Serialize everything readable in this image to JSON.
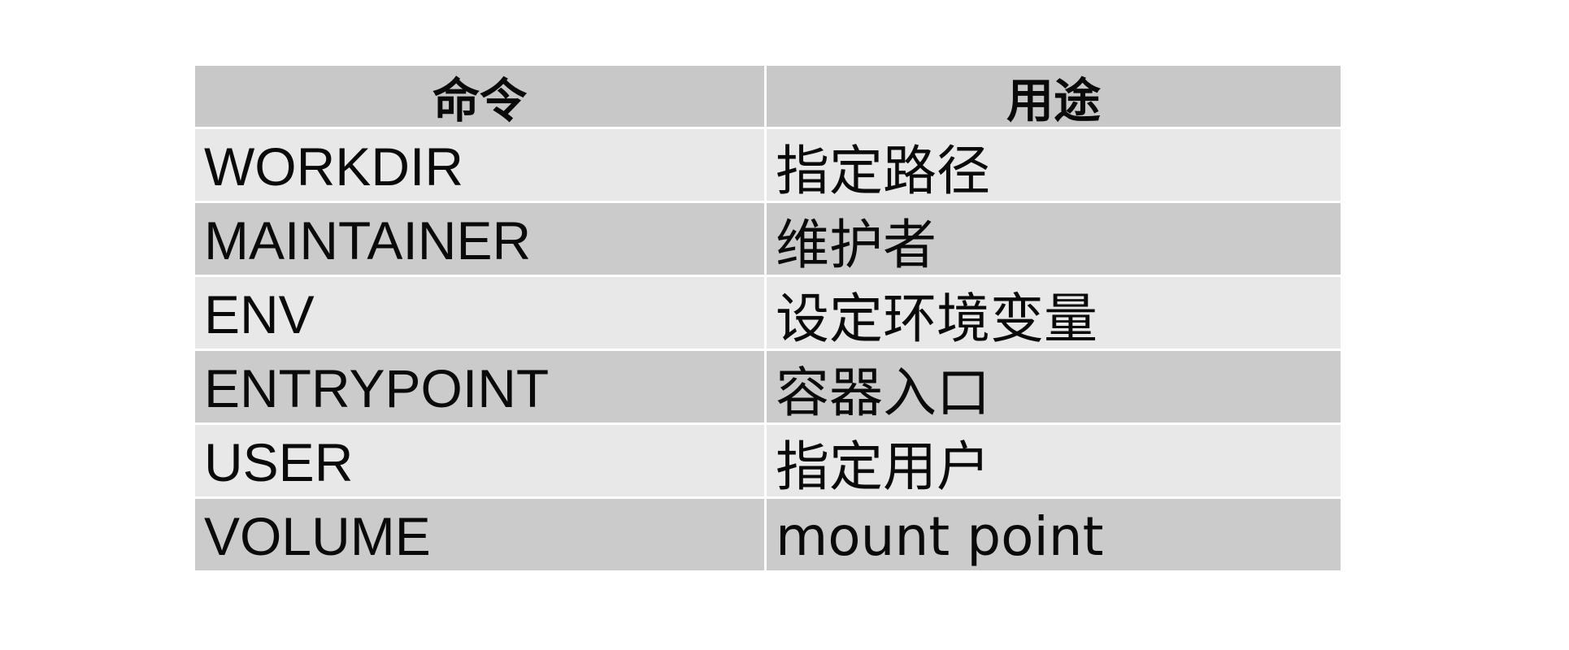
{
  "table": {
    "headers": [
      "命令",
      "用途"
    ],
    "rows": [
      {
        "command": "WORKDIR",
        "purpose": "指定路径"
      },
      {
        "command": "MAINTAINER",
        "purpose": "维护者"
      },
      {
        "command": "ENV",
        "purpose": "设定环境变量"
      },
      {
        "command": "ENTRYPOINT",
        "purpose": "容器入口"
      },
      {
        "command": "USER",
        "purpose": "指定用户"
      },
      {
        "command": "VOLUME",
        "purpose": "mount point"
      }
    ]
  },
  "colors": {
    "header_bg": "#c8c8c8",
    "row_light_bg": "#e8e8e8",
    "row_dark_bg": "#cbcbcb",
    "gridline": "#ffffff",
    "text": "#0a0a0a"
  }
}
